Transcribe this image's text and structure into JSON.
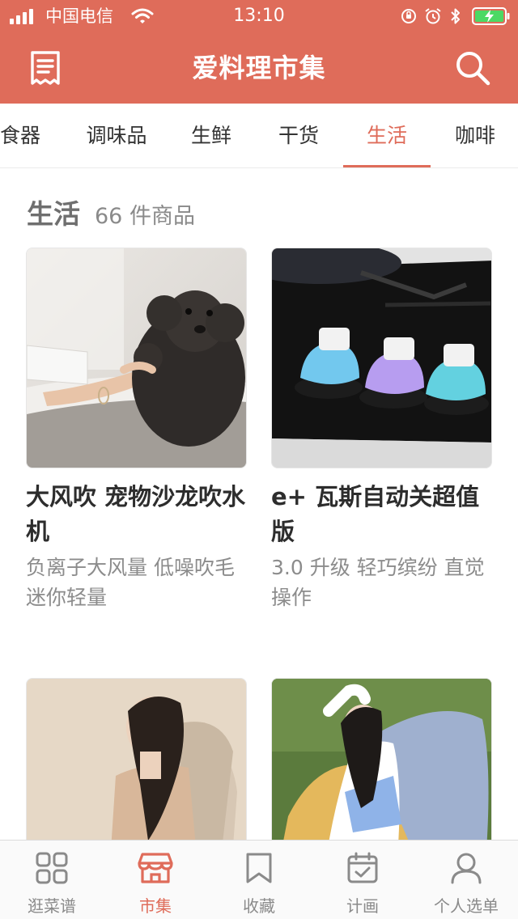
{
  "status_bar": {
    "carrier": "中国电信",
    "time": "13:10"
  },
  "nav": {
    "title": "爱料理市集",
    "left_icon": "receipt-icon",
    "right_icon": "search-icon"
  },
  "tabs": [
    {
      "label": "食器",
      "active": false
    },
    {
      "label": "调味品",
      "active": false
    },
    {
      "label": "生鲜",
      "active": false
    },
    {
      "label": "干货",
      "active": false
    },
    {
      "label": "生活",
      "active": true
    },
    {
      "label": "咖啡",
      "active": false
    }
  ],
  "section": {
    "title": "生活",
    "count": "66 件商品"
  },
  "products": [
    {
      "title": "大风吹 宠物沙龙吹水机",
      "desc": "负离子大风量 低噪吹毛 迷你轻量",
      "image": "poodle-with-pet-dryer"
    },
    {
      "title": "e+ 瓦斯自动关超值版",
      "desc": "3.0 升级 轻巧缤纷 直觉操作",
      "image": "gas-auto-shutoff-devices"
    },
    {
      "title": "",
      "desc": "",
      "image": "woman-on-massage-chair"
    },
    {
      "title": "",
      "desc": "",
      "image": "woman-on-inflatable-sofa"
    }
  ],
  "tabbar": [
    {
      "label": "逛菜谱",
      "icon": "grid-icon",
      "active": false
    },
    {
      "label": "市集",
      "icon": "store-icon",
      "active": true
    },
    {
      "label": "收藏",
      "icon": "bookmark-icon",
      "active": false
    },
    {
      "label": "计画",
      "icon": "calendar-icon",
      "active": false
    },
    {
      "label": "个人选单",
      "icon": "user-icon",
      "active": false
    }
  ],
  "colors": {
    "brand": "#df6c5a",
    "text": "#333333",
    "muted": "#8c8c8c",
    "tab_inactive": "#8a8a8a"
  }
}
